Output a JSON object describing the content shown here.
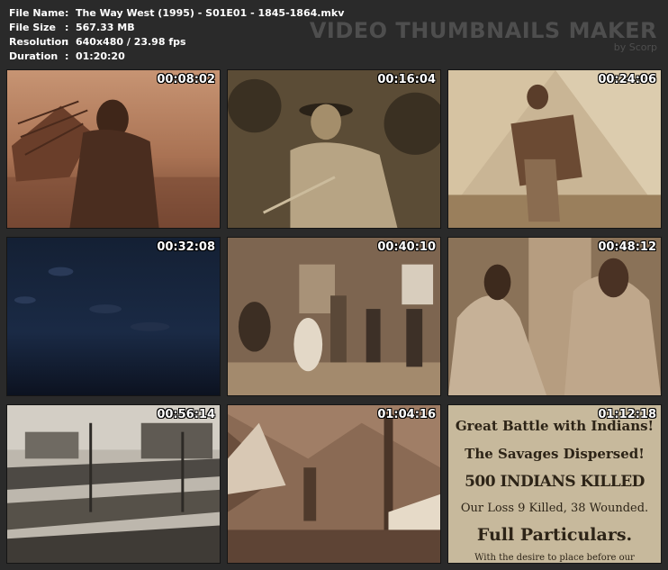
{
  "meta": {
    "file_name_label": "File Name",
    "file_name": "The Way West (1995) - S01E01 - 1845-1864.mkv",
    "file_size_label": "File Size",
    "file_size": "567.33 MB",
    "resolution_label": "Resolution",
    "resolution": "640x480 / 23.98 fps",
    "duration_label": "Duration",
    "duration": "01:20:20",
    "separator": ":"
  },
  "brand": {
    "title": "VIDEO THUMBNAILS MAKER",
    "subtitle": "by Scorp"
  },
  "thumbnails": [
    {
      "timestamp": "00:08:02"
    },
    {
      "timestamp": "00:16:04"
    },
    {
      "timestamp": "00:24:06"
    },
    {
      "timestamp": "00:32:08"
    },
    {
      "timestamp": "00:40:10"
    },
    {
      "timestamp": "00:48:12"
    },
    {
      "timestamp": "00:56:14"
    },
    {
      "timestamp": "01:04:16"
    },
    {
      "timestamp": "01:12:18"
    }
  ],
  "newspaper": {
    "line1": "Great Battle with Indians!",
    "line2": "The Savages Dispersed!",
    "line3": "500 INDIANS KILLED",
    "line4": "Our Loss 9 Killed, 38 Wounded.",
    "line5": "Full Particulars.",
    "line6": "With the desire to place before our"
  },
  "colors": {
    "background": "#2a2a2a",
    "text": "#ffffff",
    "brand": "#4e4e4e"
  }
}
